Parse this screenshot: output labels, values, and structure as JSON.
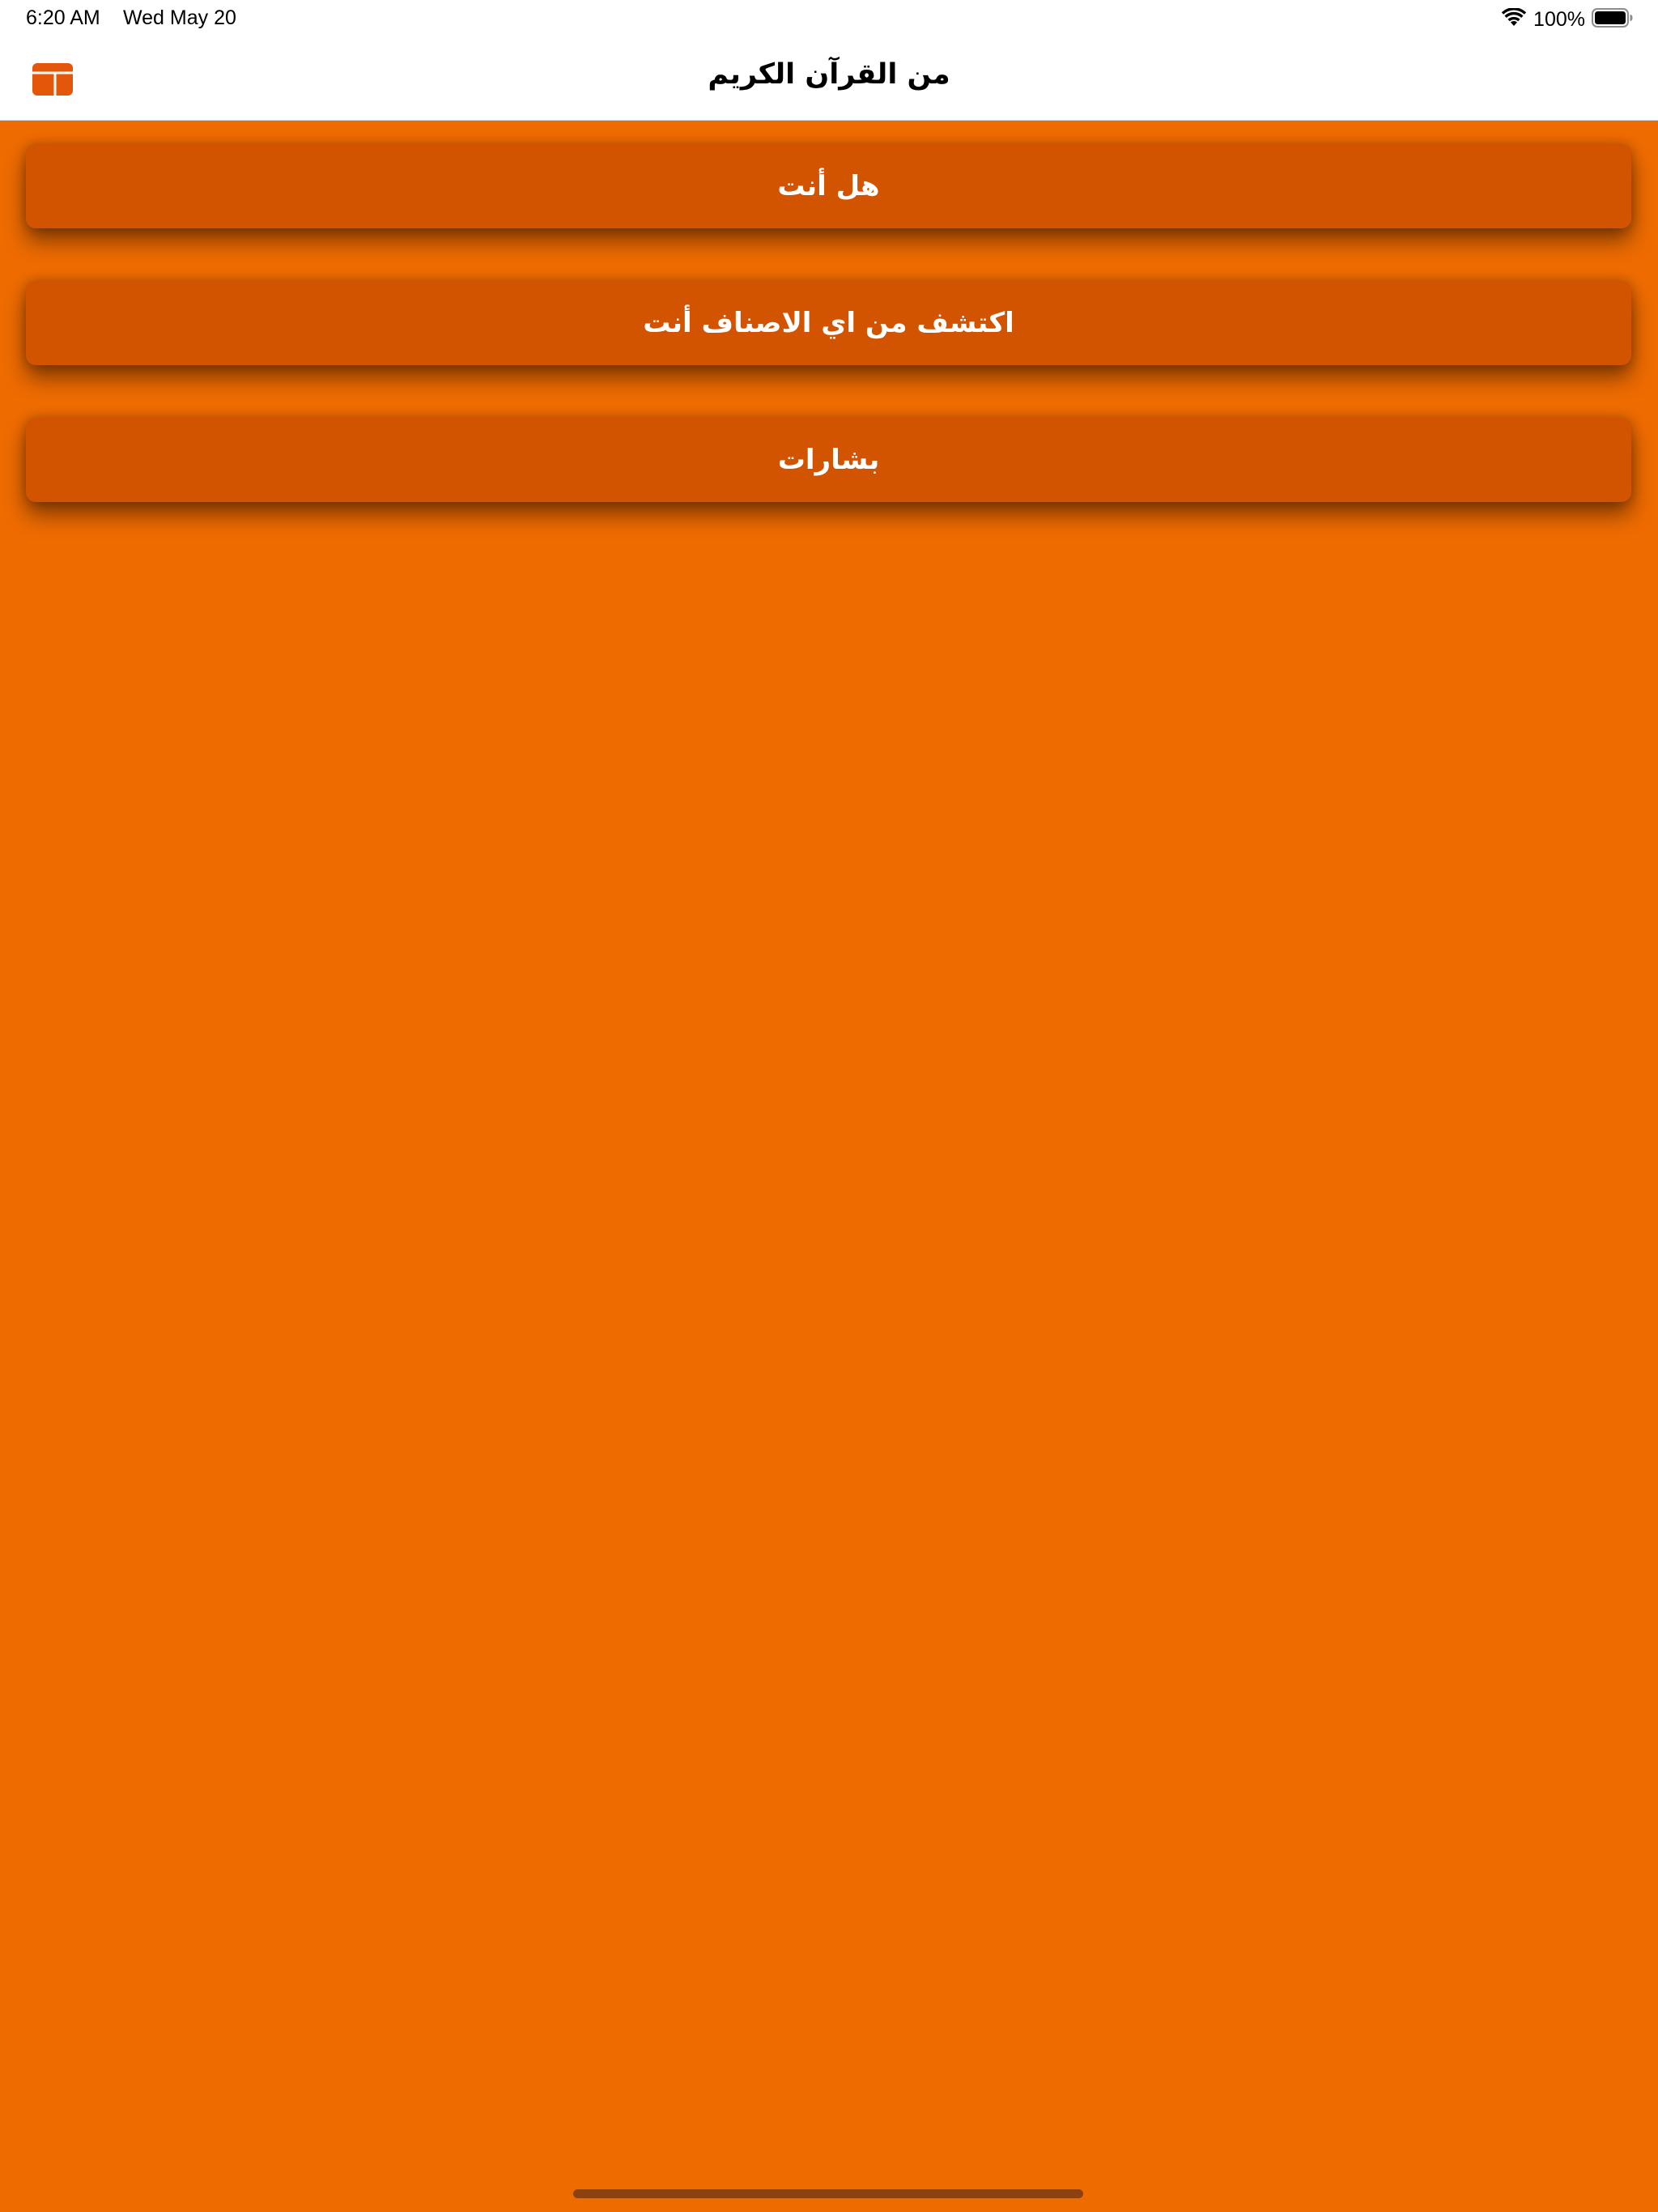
{
  "status_bar": {
    "time": "6:20 AM",
    "date": "Wed May 20",
    "battery_percent": "100%",
    "icons": [
      "wifi-icon",
      "battery-icon"
    ]
  },
  "nav_bar": {
    "title": "من القرآن الكريم",
    "sidebar_icon": "sidebar-toggle-icon"
  },
  "menu": {
    "items": [
      {
        "label": "هل أنت"
      },
      {
        "label": "اكتشف من اي الاصناف أنت"
      },
      {
        "label": "بشارات"
      }
    ]
  },
  "colors": {
    "background": "#ee6b00",
    "button": "#d25400",
    "button_text": "#ffffff",
    "accent_icon": "#e2570a"
  }
}
